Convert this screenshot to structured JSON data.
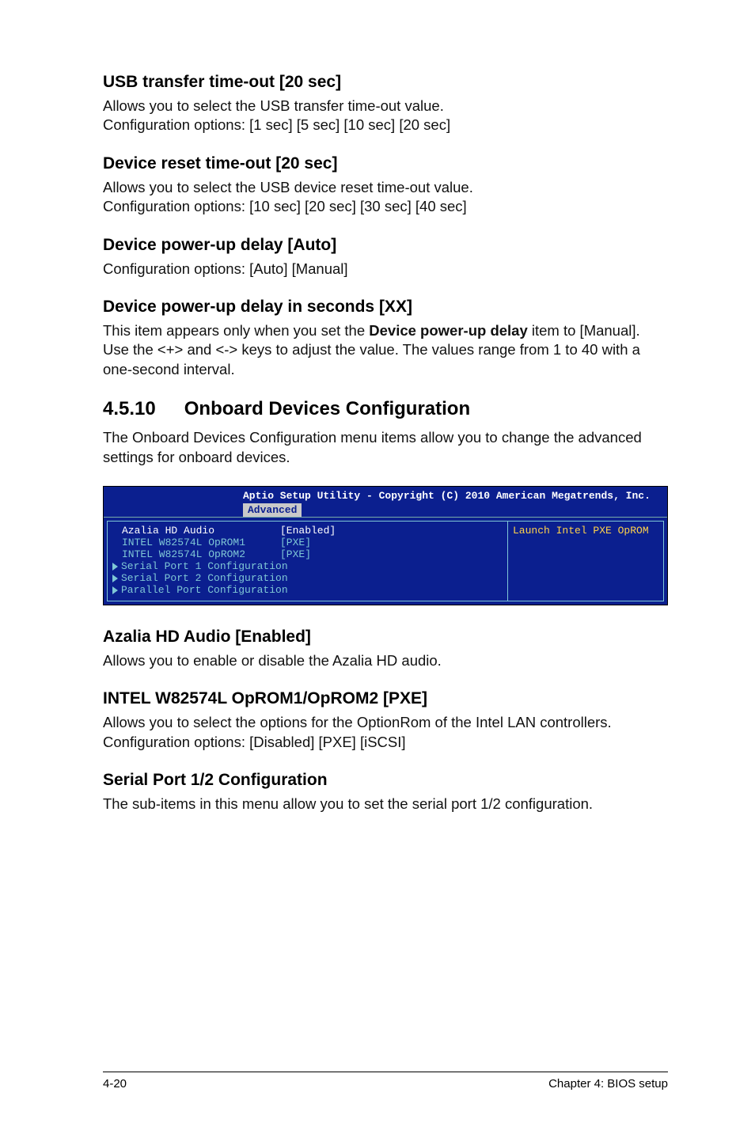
{
  "s1": {
    "h": "USB transfer time-out [20 sec]",
    "p": "Allows you to select the USB transfer time-out value.\nConfiguration options: [1 sec] [5 sec] [10 sec] [20 sec]"
  },
  "s2": {
    "h": "Device reset time-out [20 sec]",
    "p": "Allows you to select the USB device reset time-out value.\nConfiguration options: [10 sec] [20 sec] [30 sec] [40 sec]"
  },
  "s3": {
    "h": "Device power-up delay [Auto]",
    "p": "Configuration options: [Auto] [Manual]"
  },
  "s4": {
    "h": "Device power-up delay in seconds [XX]",
    "p_pre": "This item appears only when you set the ",
    "p_bold": "Device power-up delay",
    "p_post": " item to [Manual]. Use the <+> and <-> keys to adjust the value. The values range from 1 to 40 with a one-second interval."
  },
  "sec": {
    "num": "4.5.10",
    "title": "Onboard Devices Configuration",
    "p": "The Onboard Devices Configuration menu items allow you to change the advanced settings for onboard devices."
  },
  "bios": {
    "title": "Aptio Setup Utility - Copyright (C) 2010 American Megatrends, Inc.",
    "tab": "Advanced",
    "rows": [
      {
        "k": "Azalia HD Audio",
        "v": "[Enabled]",
        "hl": true
      },
      {
        "k": "INTEL W82574L OpROM1",
        "v": "[PXE]",
        "hl": false
      },
      {
        "k": "INTEL W82574L OpROM2",
        "v": "[PXE]",
        "hl": false
      }
    ],
    "subs": [
      "Serial Port 1 Configuration",
      "Serial Port 2 Configuration",
      "Parallel Port Configuration"
    ],
    "help": "Launch Intel PXE OpROM"
  },
  "s5": {
    "h": "Azalia HD Audio [Enabled]",
    "p": "Allows you to enable or disable the Azalia HD audio."
  },
  "s6": {
    "h": "INTEL W82574L OpROM1/OpROM2 [PXE]",
    "p": "Allows you to select the options for the OptionRom of the Intel LAN controllers.\nConfiguration options: [Disabled] [PXE] [iSCSI]"
  },
  "s7": {
    "h": "Serial Port 1/2 Configuration",
    "p": "The sub-items in this menu allow you to set the serial port 1/2 configuration."
  },
  "footer": {
    "left": "4-20",
    "right": "Chapter 4: BIOS setup"
  }
}
